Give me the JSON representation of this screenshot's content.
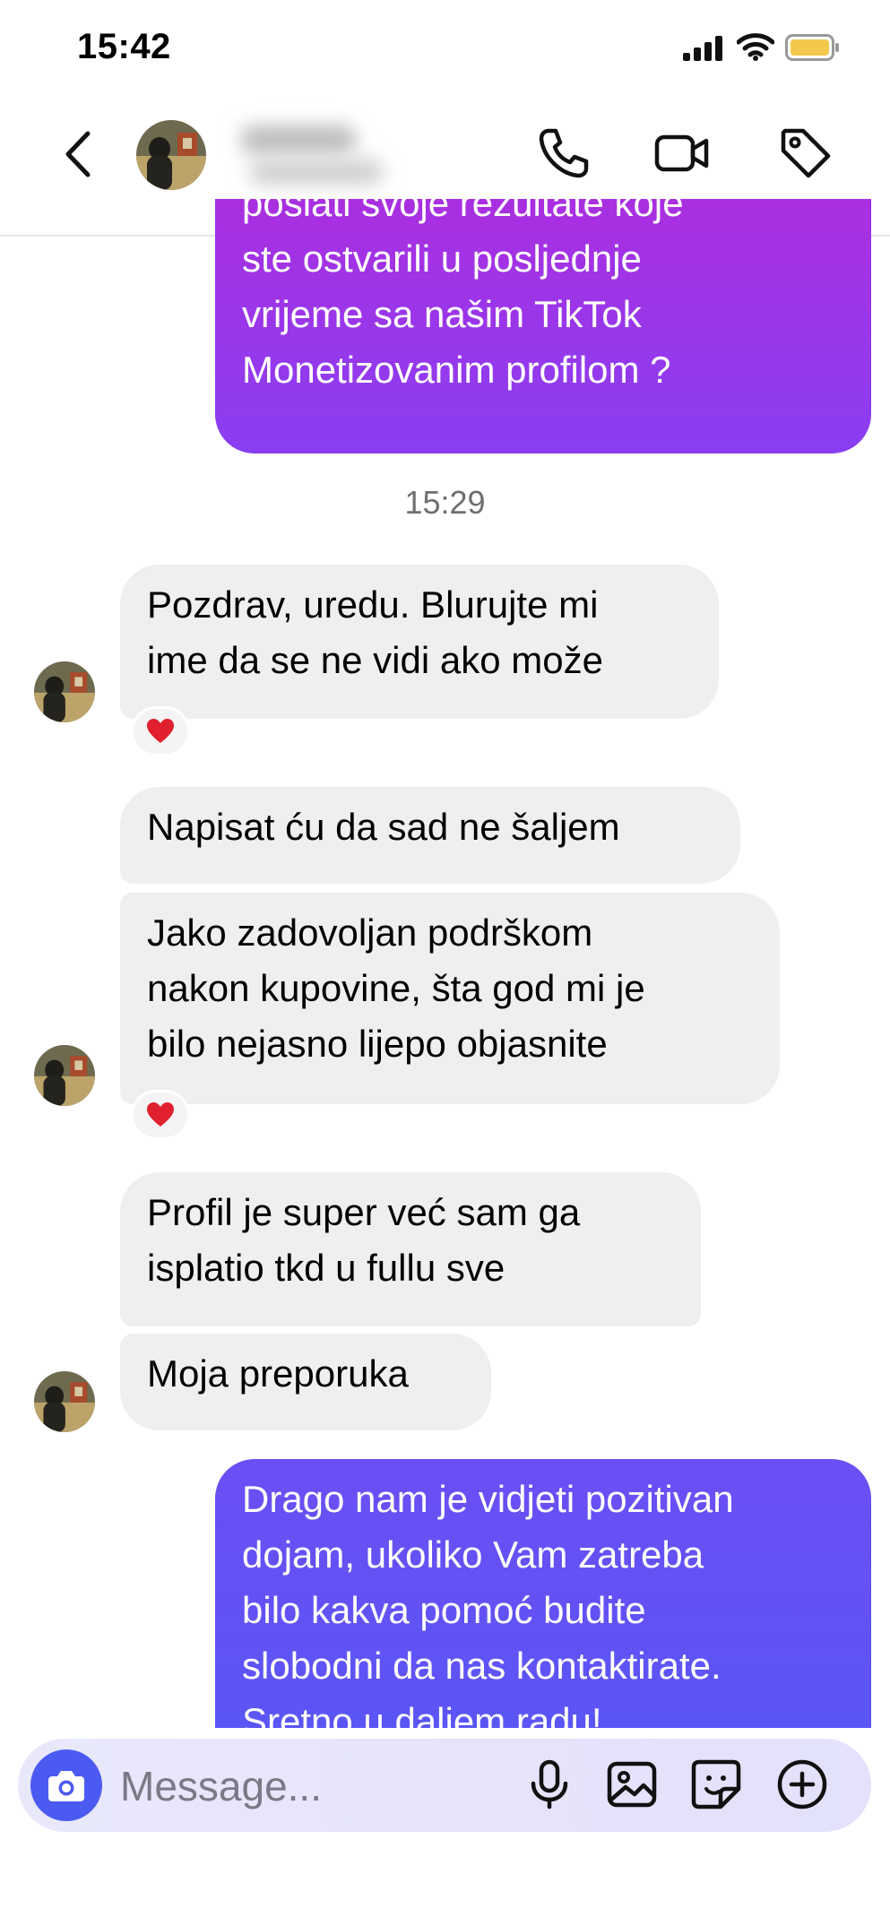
{
  "status_bar": {
    "time": "15:42",
    "signal_icon": "signal-bars-icon",
    "wifi_icon": "wifi-icon",
    "battery_icon": "battery-icon",
    "battery_color": "#f2c94c"
  },
  "header": {
    "back_icon": "chevron-left-icon",
    "call_icon": "phone-icon",
    "video_icon": "video-camera-icon",
    "tag_icon": "tag-icon"
  },
  "conversation": {
    "outgoing_top": {
      "lines": [
        "poslati svoje rezultate koje",
        "ste ostvarili u posljednje",
        "vrijeme sa našim TikTok",
        "Monetizovanim profilom ?"
      ]
    },
    "timestamp": "15:29",
    "incoming": [
      {
        "lines": [
          "Pozdrav, uredu. Blurujte mi",
          "ime da se ne vidi ako može"
        ],
        "reaction": "❤️"
      },
      {
        "lines": [
          "Napisat ću da sad ne šaljem"
        ]
      },
      {
        "lines": [
          "Jako zadovoljan podrškom",
          "nakon kupovine, šta god mi je",
          "bilo nejasno lijepo objasnite"
        ],
        "reaction": "❤️"
      },
      {
        "lines": [
          "Profil je super već sam ga",
          "isplatio tkd u fullu sve"
        ]
      },
      {
        "lines": [
          "Moja preporuka"
        ]
      }
    ],
    "outgoing_bottom": {
      "lines": [
        "Drago nam je vidjeti pozitivan",
        "dojam, ukoliko Vam zatreba",
        "bilo kakva pomoć budite",
        "slobodni da nas kontaktirate.",
        "Sretno u daljem radu!"
      ]
    }
  },
  "composer": {
    "placeholder": "Message...",
    "camera_icon": "camera-icon",
    "mic_icon": "microphone-icon",
    "gallery_icon": "gallery-icon",
    "sticker_icon": "sticker-icon",
    "plus_icon": "plus-circle-icon",
    "accent": "#4b5bf2"
  },
  "colors": {
    "outgoing_top": "#a92fe0",
    "outgoing_bottom": "#5b55f5",
    "incoming_bubble": "#efeff0"
  }
}
